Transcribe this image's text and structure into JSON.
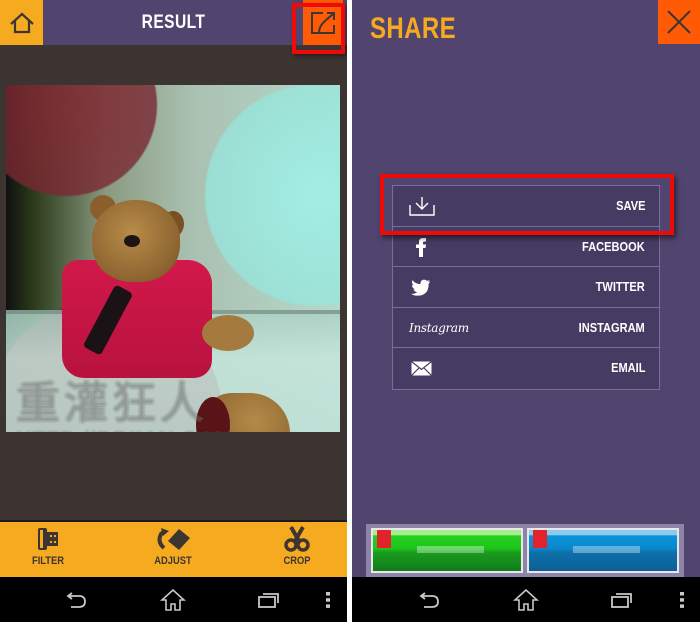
{
  "left_screen": {
    "header": {
      "title": "RESULT",
      "home_icon": "home-icon",
      "share_icon": "share-export-icon"
    },
    "photo": {
      "description": "teddy-bear-photo",
      "watermark_cn": "重灌狂人",
      "watermark_url": "HTTP://BRIIAN.COM"
    },
    "toolbar": {
      "items": [
        {
          "label": "FILTER",
          "icon": "film-roll-icon"
        },
        {
          "label": "ADJUST",
          "icon": "rotate-adjust-icon"
        },
        {
          "label": "CROP",
          "icon": "scissors-icon"
        }
      ]
    }
  },
  "right_screen": {
    "header": {
      "title": "SHARE",
      "close_icon": "close-icon"
    },
    "share_options": [
      {
        "label": "SAVE",
        "icon": "download-tray-icon"
      },
      {
        "label": "FACEBOOK",
        "icon": "facebook-icon"
      },
      {
        "label": "TWITTER",
        "icon": "twitter-bird-icon"
      },
      {
        "label": "INSTAGRAM",
        "icon": "instagram-wordmark",
        "icon_text": "Instagram"
      },
      {
        "label": "EMAIL",
        "icon": "envelope-icon"
      }
    ],
    "ad_banner": {
      "buttons": [
        "green-ad-button",
        "blue-ad-button"
      ]
    }
  },
  "system_nav": {
    "buttons": [
      "back",
      "home",
      "recent-apps",
      "overflow-menu"
    ]
  },
  "annotations": {
    "highlight_color": "#ef0a0a",
    "highlighted": [
      "share-button",
      "share-item-save"
    ]
  },
  "colors": {
    "header_purple": "#51456f",
    "accent_yellow": "#f6aa1f",
    "accent_orange": "#ff5a05",
    "photo_bg": "#3b3430",
    "list_item_bg": "#463b62"
  }
}
